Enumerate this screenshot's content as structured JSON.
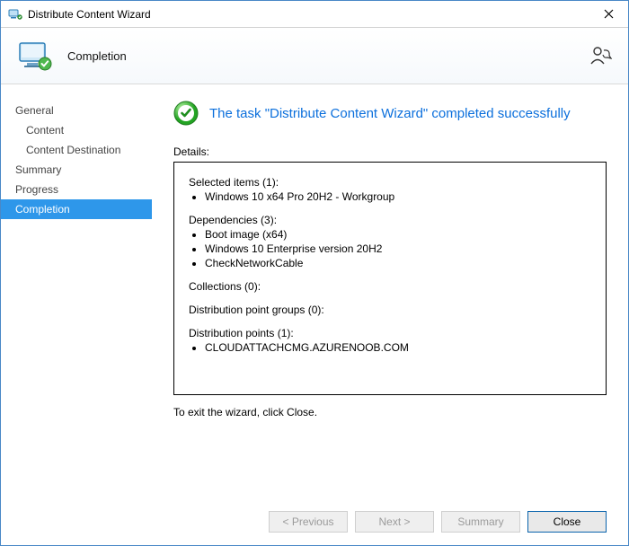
{
  "titlebar": {
    "title": "Distribute Content Wizard"
  },
  "header": {
    "step_title": "Completion"
  },
  "sidebar": {
    "items": [
      {
        "label": "General",
        "indent": false,
        "active": false
      },
      {
        "label": "Content",
        "indent": true,
        "active": false
      },
      {
        "label": "Content Destination",
        "indent": true,
        "active": false
      },
      {
        "label": "Summary",
        "indent": false,
        "active": false
      },
      {
        "label": "Progress",
        "indent": false,
        "active": false
      },
      {
        "label": "Completion",
        "indent": false,
        "active": true
      }
    ]
  },
  "main": {
    "status_message": "The task \"Distribute Content Wizard\" completed successfully",
    "details_label": "Details:",
    "details": {
      "selected_items": {
        "title": "Selected items (1):",
        "items": [
          "Windows 10 x64 Pro 20H2 - Workgroup"
        ]
      },
      "dependencies": {
        "title": "Dependencies (3):",
        "items": [
          "Boot image (x64)",
          "Windows 10 Enterprise version 20H2",
          "CheckNetworkCable"
        ]
      },
      "collections": {
        "title": "Collections (0):",
        "items": []
      },
      "dp_groups": {
        "title": "Distribution point groups (0):",
        "items": []
      },
      "dp": {
        "title": "Distribution points (1):",
        "items": [
          "CLOUDATTACHCMG.AZURENOOB.COM"
        ]
      }
    },
    "exit_hint": "To exit the wizard, click Close."
  },
  "buttons": {
    "previous": "< Previous",
    "next": "Next >",
    "summary": "Summary",
    "close": "Close"
  }
}
